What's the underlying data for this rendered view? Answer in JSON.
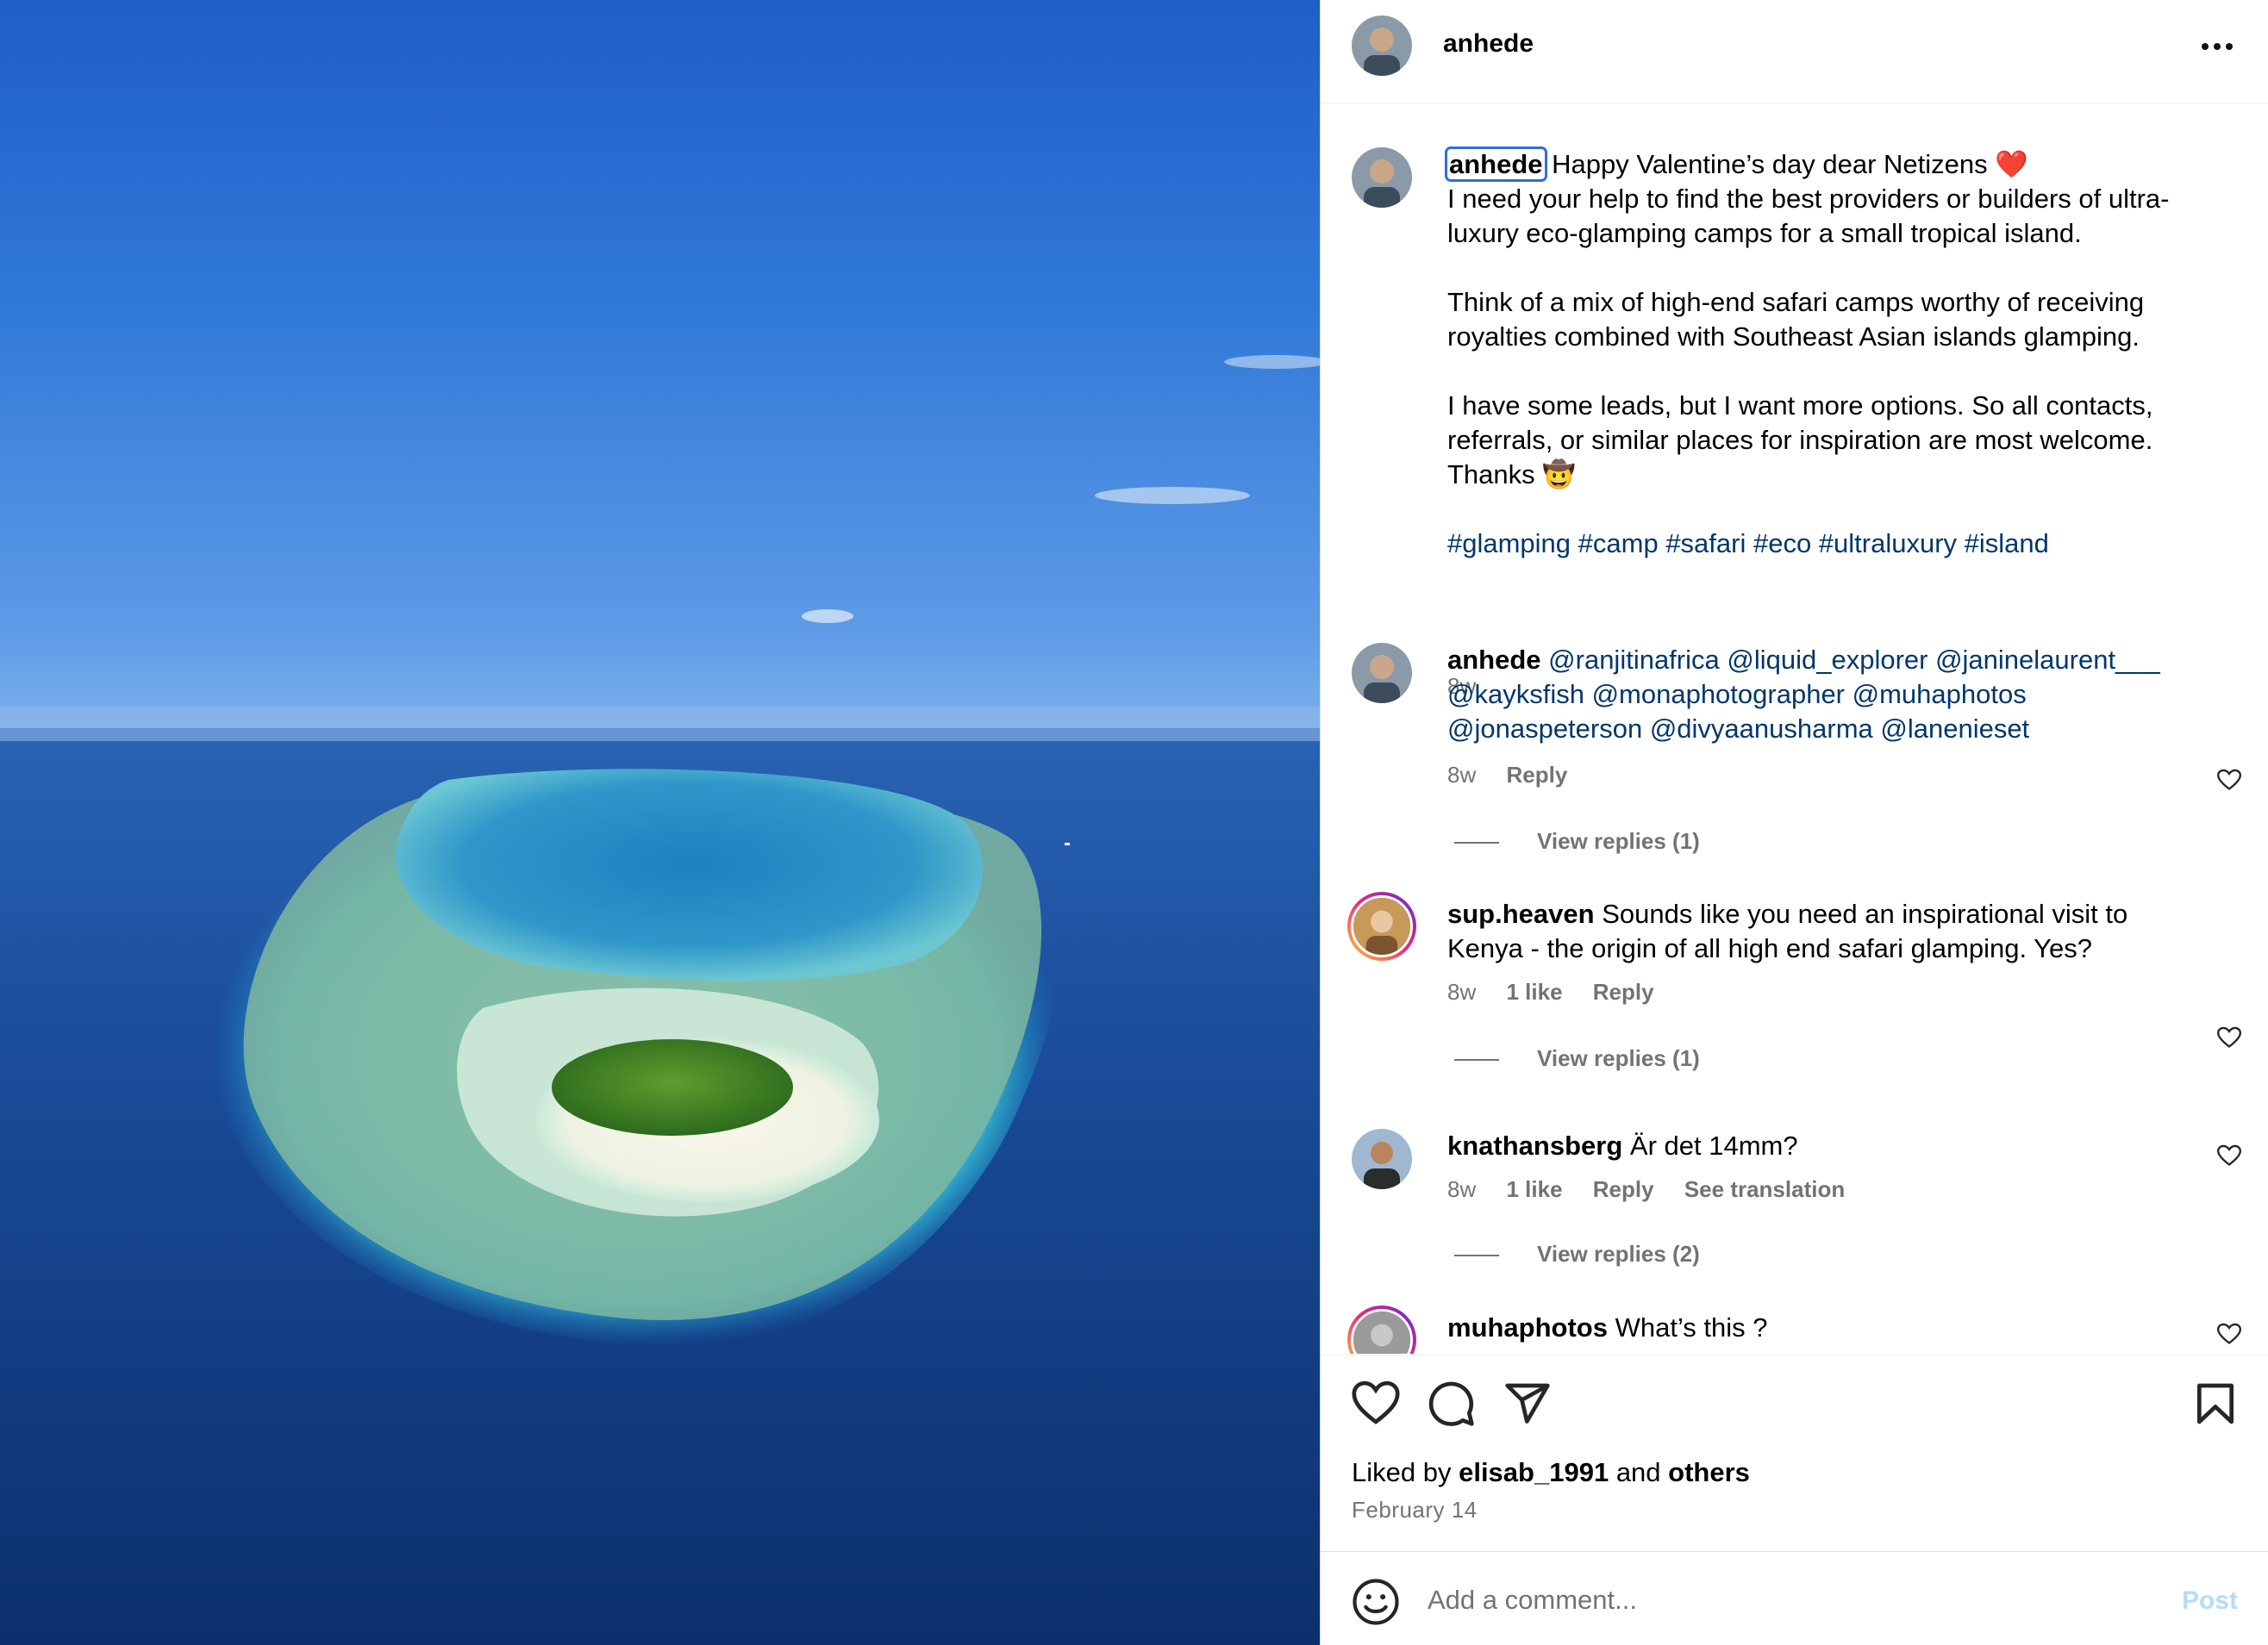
{
  "post": {
    "username": "anhede",
    "caption": {
      "username": "anhede",
      "line1": "Happy Valentine’s day dear Netizens ❤️",
      "para1": "I need your help to find the best providers or builders of ultra-luxury eco-glamping camps for a small tropical island.",
      "para2": "Think of a mix of high-end safari camps worthy of receiving royalties combined with Southeast Asian islands glamping.",
      "para3": "I have some leads, but I want more options. So all contacts, referrals, or similar places for inspiration are most welcome.",
      "thanks": "Thanks 🤠",
      "hashtags": "#glamping #camp #safari #eco #ultraluxury #island",
      "time": "8w"
    },
    "comments": [
      {
        "username": "anhede",
        "text": "@ranjitinafrica @liquid_explorer @janinelaurent___ @kayksfish @monaphotographer @muhaphotos @jonaspeterson @divyaanusharma @lanenieset",
        "time": "8w",
        "reply": "Reply",
        "view_replies": "View replies (1)"
      },
      {
        "username": "sup.heaven",
        "text": "Sounds like you need an inspirational visit to Kenya - the origin of all high end safari glamping. Yes?",
        "time": "8w",
        "likes": "1 like",
        "reply": "Reply",
        "view_replies": "View replies (1)"
      },
      {
        "username": "knathansberg",
        "text": "Är det 14mm?",
        "time": "8w",
        "likes": "1 like",
        "reply": "Reply",
        "translation": "See translation",
        "view_replies": "View replies (2)"
      },
      {
        "username": "muhaphotos",
        "text": "What’s this ?"
      }
    ],
    "liked_by": {
      "prefix": "Liked by",
      "user": "elisab_1991",
      "and": "and",
      "others": "others"
    },
    "date": "February 14",
    "add_comment_placeholder": "Add a comment...",
    "post_button": "Post"
  },
  "colors": {
    "link": "#00376b",
    "muted": "#737373",
    "post_button": "#b3dbff",
    "focus": "#2f6de1"
  },
  "icons": [
    "more-horizontal-icon",
    "heart-icon",
    "comment-icon",
    "share-icon",
    "bookmark-icon",
    "emoji-icon"
  ]
}
